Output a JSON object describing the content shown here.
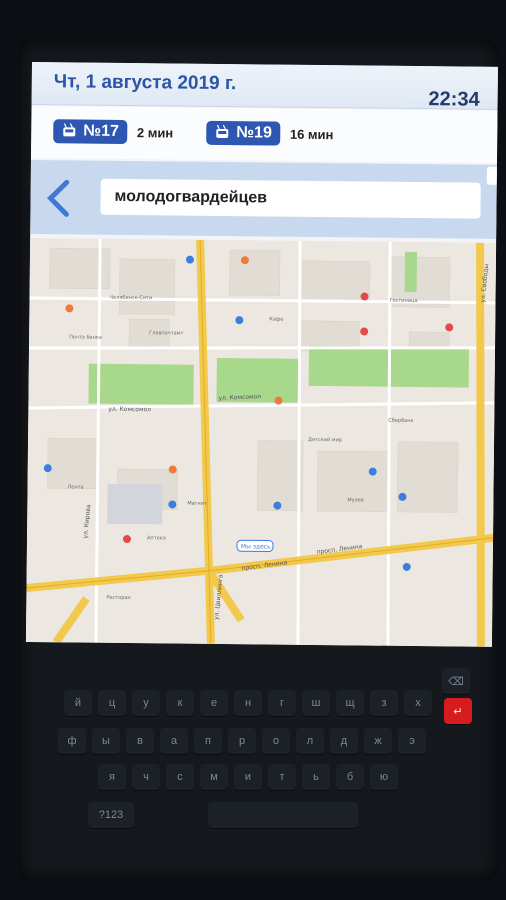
{
  "status": {
    "date": "Чт, 1 августа 2019 г.",
    "time": "22:34"
  },
  "routes": [
    {
      "number": "№17",
      "eta": "2 мин"
    },
    {
      "number": "№19",
      "eta": "16 мин"
    }
  ],
  "search": {
    "value": "молодогвардейцев"
  },
  "map": {
    "streets": [
      "ул. Комсомол",
      "ул. Комсомол",
      "просп. Ленина",
      "просп. Ленина",
      "ул. Цвиллинга",
      "ул. Кирова",
      "ул. Свободы"
    ],
    "bus_stop": "Мы здесь",
    "places": [
      "Главпочтамт",
      "Челябинск-Сити",
      "Почта банка",
      "Сбербанк",
      "Детский мир",
      "Лента",
      "Магнит",
      "Гостиница",
      "Кафе",
      "Аптека",
      "Музей",
      "Ресторан"
    ]
  },
  "keyboard": {
    "row1": [
      "й",
      "ц",
      "у",
      "к",
      "е",
      "н",
      "г",
      "ш",
      "щ",
      "з",
      "х"
    ],
    "row2": [
      "ф",
      "ы",
      "в",
      "а",
      "п",
      "р",
      "о",
      "л",
      "д",
      "ж",
      "э"
    ],
    "row3": [
      "я",
      "ч",
      "с",
      "м",
      "и",
      "т",
      "ь",
      "б",
      "ю"
    ],
    "backspace": "⌫",
    "enter": "↵",
    "numbers": "?123",
    "space": ""
  }
}
